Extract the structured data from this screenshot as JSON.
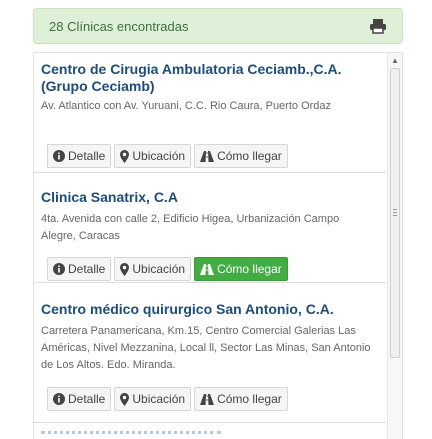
{
  "results": {
    "count_text": "28 Clínicas encontradas"
  },
  "clinics": [
    {
      "name": "Centro de Cirugia Ambulatoria Ceciamb.,C.A. (Grupo Ceciamb)",
      "address": "Av. Atlantico con Av. Yuruani, C.C. Rio Caura, Puerto Ordaz",
      "buttons": {
        "detail": "Detalle",
        "location": "Ubicación",
        "directions": "Cómo llegar"
      }
    },
    {
      "name": "Clinica Sanatrix, C.A",
      "address": "4ta. Avenida con calle 2, Edificio Higea, Urbanización Campo Alegre, Caracas",
      "buttons": {
        "detail": "Detalle",
        "location": "Ubicación",
        "directions": "Cómo llegar"
      }
    },
    {
      "name": "Centro médico quirurgico San Antonio, C.A.",
      "address": "Carretera Panamericana, Km.15, Centro Comercial Galerias Las Américas, Nivel Mezzanina, Local ll, Sector Las Minas, San Antonio de Los Altos. Edo. Miranda.",
      "buttons": {
        "detail": "Detalle",
        "location": "Ubicación",
        "directions": "Cómo llegar"
      }
    }
  ],
  "icons": {
    "print": "print-icon",
    "detail": "info-circle-icon",
    "location": "map-marker-icon",
    "directions": "road-icon"
  },
  "colors": {
    "banner_bg": "#dff0d8",
    "title": "#1d4c78",
    "active_button": "#43ac43"
  }
}
